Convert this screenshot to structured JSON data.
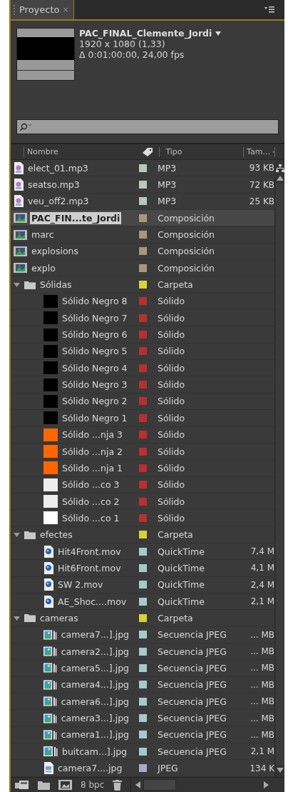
{
  "panel": {
    "tab": "Proyecto",
    "close": "×"
  },
  "preview": {
    "name": "PAC_FINAL_Clemente_Jordi",
    "dimensions": "1920 x 1080 (1,33)",
    "duration": "Δ 0:01:00:00, 24,00 fps"
  },
  "columns": [
    "Nombre",
    "Tipo",
    "Tam..."
  ],
  "rows": [
    {
      "kind": "mp3",
      "name": "elect_01.mp3",
      "color": "#b9c9bb",
      "type": "MP3",
      "size": "93 KB",
      "selected": false
    },
    {
      "kind": "mp3",
      "name": "seatso.mp3",
      "color": "#b9c9bb",
      "type": "MP3",
      "size": "72 KB",
      "selected": false
    },
    {
      "kind": "mp3",
      "name": "veu_off2.mp3",
      "color": "#b9c9bb",
      "type": "MP3",
      "size": "25 KB",
      "selected": false
    },
    {
      "kind": "comp",
      "name": "PAC_FIN...te_Jordi",
      "color": "#a8977a",
      "type": "Composición",
      "selected": true
    },
    {
      "kind": "comp",
      "name": "marc",
      "color": "#a8977a",
      "type": "Composición",
      "selected": false
    },
    {
      "kind": "comp",
      "name": "explosions",
      "color": "#a8977a",
      "type": "Composición",
      "selected": false
    },
    {
      "kind": "comp",
      "name": "explo",
      "color": "#a8977a",
      "type": "Composición",
      "selected": false
    },
    {
      "kind": "folder",
      "name": "Sólidas",
      "color": "#d8d03c",
      "type": "Carpeta",
      "selected": false,
      "expanded": true,
      "children": [
        {
          "kind": "solid",
          "name": "Sólido Negro 8",
          "swatch": {
            "color": "#000000"
          },
          "color": "#b8302c",
          "type": "Sólido",
          "selected": false
        },
        {
          "kind": "solid",
          "name": "Sólido Negro 7",
          "swatch": {
            "color": "#000000"
          },
          "color": "#b8302c",
          "type": "Sólido",
          "selected": false
        },
        {
          "kind": "solid",
          "name": "Sólido Negro 6",
          "swatch": {
            "color": "#000000"
          },
          "color": "#b8302c",
          "type": "Sólido",
          "selected": false
        },
        {
          "kind": "solid",
          "name": "Sólido Negro 5",
          "swatch": {
            "color": "#000000"
          },
          "color": "#b8302c",
          "type": "Sólido",
          "selected": false
        },
        {
          "kind": "solid",
          "name": "Sólido Negro 4",
          "swatch": {
            "color": "#000000"
          },
          "color": "#b8302c",
          "type": "Sólido",
          "selected": false
        },
        {
          "kind": "solid",
          "name": "Sólido Negro 3",
          "swatch": {
            "color": "#000000"
          },
          "color": "#b8302c",
          "type": "Sólido",
          "selected": false
        },
        {
          "kind": "solid",
          "name": "Sólido Negro 2",
          "swatch": {
            "color": "#000000"
          },
          "color": "#b8302c",
          "type": "Sólido",
          "selected": false
        },
        {
          "kind": "solid",
          "name": "Sólido Negro 1",
          "swatch": {
            "color": "#000000"
          },
          "color": "#b8302c",
          "type": "Sólido",
          "selected": false
        },
        {
          "kind": "solid",
          "name": "Sólido ...nja 3",
          "swatch": {
            "color": "#ff6600"
          },
          "color": "#b8302c",
          "type": "Sólido",
          "selected": false
        },
        {
          "kind": "solid",
          "name": "Sólido ...nja 2",
          "swatch": {
            "color": "#ff6600"
          },
          "color": "#b8302c",
          "type": "Sólido",
          "selected": false
        },
        {
          "kind": "solid",
          "name": "Sólido ...nja 1",
          "swatch": {
            "color": "#ff6600"
          },
          "color": "#b8302c",
          "type": "Sólido",
          "selected": false
        },
        {
          "kind": "solid",
          "name": "Sólido ...co 3",
          "swatch": {
            "color": "#eeeeee"
          },
          "color": "#b8302c",
          "type": "Sólido",
          "selected": false
        },
        {
          "kind": "solid",
          "name": "Sólido ...co 2",
          "swatch": {
            "color": "#eeeeee"
          },
          "color": "#b8302c",
          "type": "Sólido",
          "selected": false
        },
        {
          "kind": "solid",
          "name": "Sólido ...co 1",
          "swatch": {
            "color": "#ffffff"
          },
          "color": "#b8302c",
          "type": "Sólido",
          "selected": false
        }
      ]
    },
    {
      "kind": "folder",
      "name": "efectes",
      "color": "#d8d03c",
      "type": "Carpeta",
      "selected": false,
      "expanded": true,
      "children": [
        {
          "kind": "mov",
          "name": "Hit4Front.mov",
          "color": "#a6cbc6",
          "type": "QuickTime",
          "size": "7,4 M",
          "selected": false
        },
        {
          "kind": "mov",
          "name": "Hit6Front.mov",
          "color": "#a6cbc6",
          "type": "QuickTime",
          "size": "4,1 M",
          "selected": false
        },
        {
          "kind": "mov",
          "name": "SW 2.mov",
          "color": "#a6cbc6",
          "type": "QuickTime",
          "size": "2,4 M",
          "selected": false
        },
        {
          "kind": "mov",
          "name": "AE_Shoc....mov",
          "color": "#a6cbc6",
          "type": "QuickTime",
          "size": "2,1 M",
          "selected": false
        }
      ]
    },
    {
      "kind": "folder",
      "name": "cameras",
      "color": "#d8d03c",
      "type": "Carpeta",
      "selected": false,
      "expanded": true,
      "children": [
        {
          "kind": "sequence",
          "name": "camera7...].jpg",
          "color": "#a6cbc6",
          "type": "Secuencia JPEG",
          "size": "... MB",
          "selected": false
        },
        {
          "kind": "sequence",
          "name": "camera2...].jpg",
          "color": "#a6cbc6",
          "type": "Secuencia JPEG",
          "size": "... MB",
          "selected": false
        },
        {
          "kind": "sequence",
          "name": "camera5...].jpg",
          "color": "#a6cbc6",
          "type": "Secuencia JPEG",
          "size": "... MB",
          "selected": false
        },
        {
          "kind": "sequence",
          "name": "camera4...].jpg",
          "color": "#a6cbc6",
          "type": "Secuencia JPEG",
          "size": "... MB",
          "selected": false
        },
        {
          "kind": "sequence",
          "name": "camera6...].jpg",
          "color": "#a6cbc6",
          "type": "Secuencia JPEG",
          "size": "... MB",
          "selected": false
        },
        {
          "kind": "sequence",
          "name": "camera3...].jpg",
          "color": "#a6cbc6",
          "type": "Secuencia JPEG",
          "size": "... MB",
          "selected": false
        },
        {
          "kind": "sequence",
          "name": "camera1...].jpg",
          "color": "#a6cbc6",
          "type": "Secuencia JPEG",
          "size": "... MB",
          "selected": false
        },
        {
          "kind": "sequence",
          "name": "buitcam...].jpg",
          "color": "#a6cbc6",
          "type": "Secuencia JPEG",
          "size": "2,1 M",
          "selected": false
        },
        {
          "kind": "image",
          "name": "camera7....jpg",
          "color": "#a9a9cf",
          "type": "JPEG",
          "size": "134 K",
          "selected": false
        }
      ]
    }
  ],
  "footer": {
    "bit_depth": "8 bpc"
  }
}
